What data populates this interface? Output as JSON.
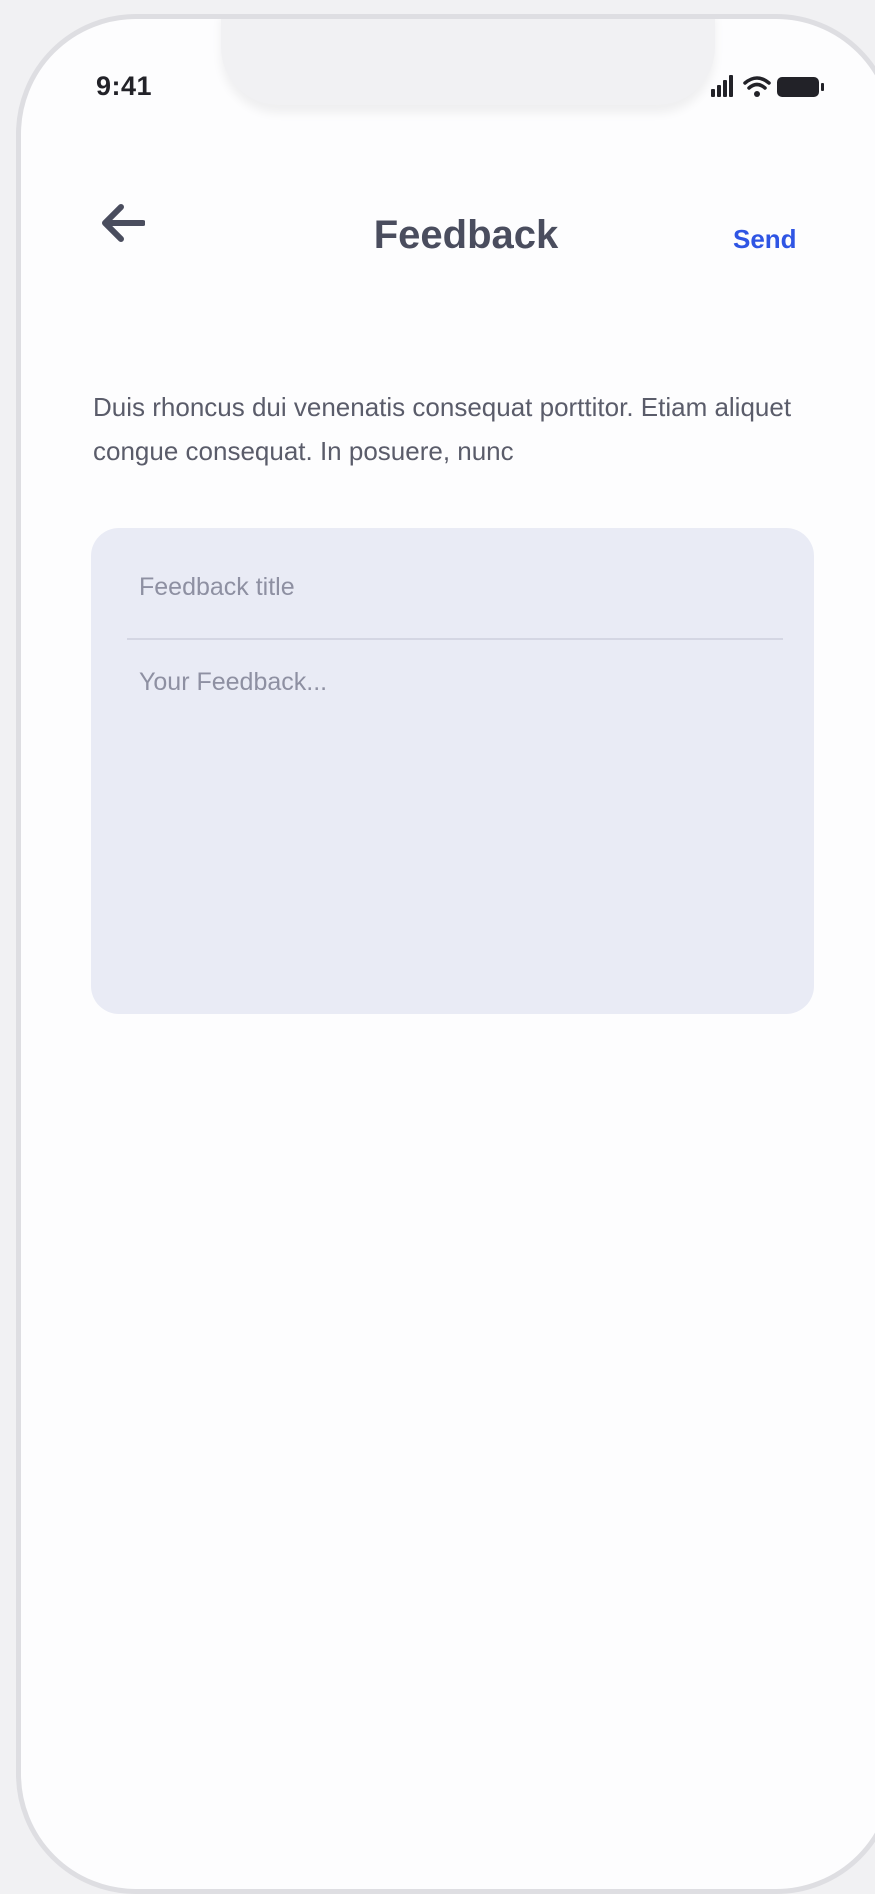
{
  "status_bar": {
    "time": "9:41",
    "icons": [
      "signal-icon",
      "wifi-icon",
      "battery-icon"
    ]
  },
  "header": {
    "back_icon": "arrow-left-icon",
    "title": "Feedback",
    "send_label": "Send"
  },
  "description": "Duis rhoncus dui venenatis consequat porttitor. Etiam aliquet congue consequat. In posuere, nunc",
  "form": {
    "title_placeholder": "Feedback title",
    "title_value": "",
    "body_placeholder": "Your Feedback...",
    "body_value": ""
  },
  "colors": {
    "accent": "#2f55e4",
    "title_text": "#4a4d5e",
    "card_background": "#e9ebf5",
    "placeholder": "#8e90a2"
  }
}
